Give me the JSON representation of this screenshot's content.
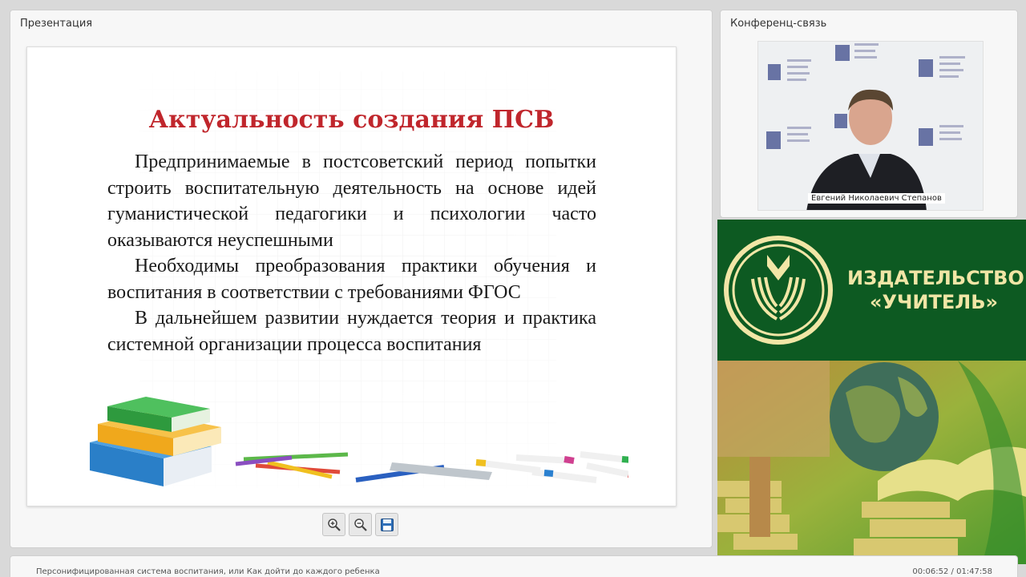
{
  "presentation": {
    "title": "Презентация",
    "slide": {
      "heading": "Актуальность создания ПСВ",
      "paragraphs": [
        "Предпринимаемые в постсоветский период попытки строить воспитательную деятельность на основе идей гуманистической педагогики и психологии часто оказываются неуспешными",
        "Необходимы преобразования практики обучения и воспитания в соответствии с требованиями ФГОС",
        "В дальнейшем развитии нуждается теория и практика системной организации процесса воспитания"
      ],
      "heading_color": "#c0262c"
    },
    "toolbar": [
      {
        "icon": "zoom-in-icon"
      },
      {
        "icon": "zoom-out-icon"
      },
      {
        "icon": "save-icon"
      }
    ]
  },
  "conference": {
    "title": "Конференц-связь",
    "speaker_name": "Евгений Николаевич Степанов"
  },
  "publisher": {
    "name_line1": "ИЗДАТЕЛЬСТВО",
    "name_line2": "«УЧИТЕЛЬ»",
    "brand_color": "#0d5a22",
    "accent_color": "#f1e6a6"
  },
  "status_bar": {
    "lecture_title": "Персонифицированная система воспитания, или Как дойти до каждого ребенка",
    "time_current": "00:06:52",
    "time_separator": " / ",
    "time_total": "01:47:58"
  }
}
